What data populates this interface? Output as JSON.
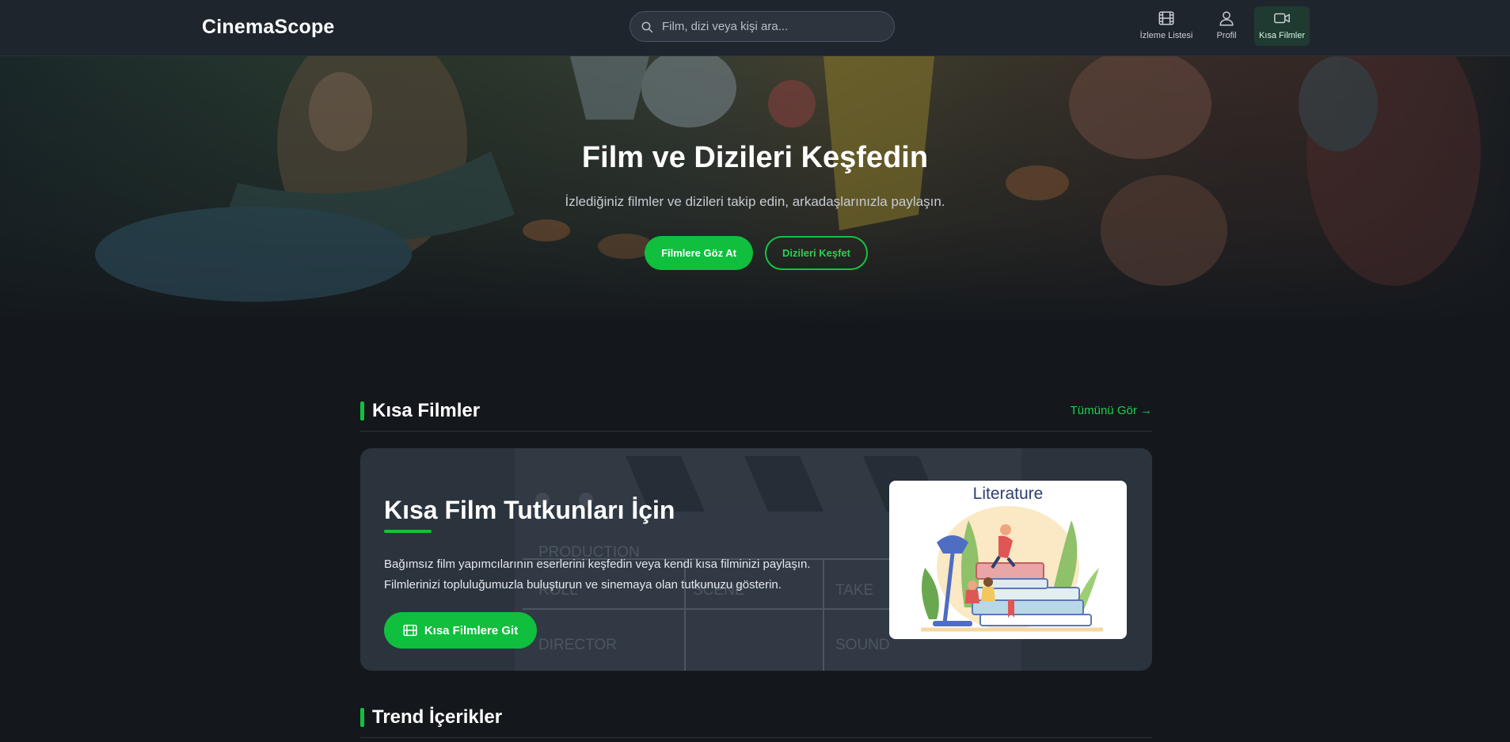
{
  "header": {
    "logo": "CinemaScope",
    "search_placeholder": "Film, dizi veya kişi ara...",
    "nav": [
      {
        "label": "İzleme Listesi",
        "icon": "film-icon",
        "active": false
      },
      {
        "label": "Profil",
        "icon": "user-icon",
        "active": false
      },
      {
        "label": "Kısa Filmler",
        "icon": "video-icon",
        "active": true
      }
    ]
  },
  "hero": {
    "title": "Film ve Dizileri Keşfedin",
    "subtitle": "İzlediğiniz filmler ve dizileri takip edin, arkadaşlarınızla paylaşın.",
    "primary_button": "Filmlere Göz At",
    "secondary_button": "Dizileri Keşfet"
  },
  "short_films": {
    "section_title": "Kısa Filmler",
    "see_all": "Tümünü Gör →",
    "card_title": "Kısa Film Tutkunları İçin",
    "description_line1": "Bağımsız film yapımcılarının eserlerini keşfedin veya kendi kısa filminizi paylaşın.",
    "description_line2": "Filmlerinizi topluluğumuzla buluşturun ve sinemaya olan tutkunuzu gösterin.",
    "button_label": "Kısa Filmlere Git",
    "illustration_label": "Literature",
    "clapper_text": {
      "production": "PRODUCTION",
      "roll": "ROLL",
      "scene": "SCENE",
      "take": "TAKE",
      "director": "DIRECTOR",
      "sound": "SOUND"
    }
  },
  "trending": {
    "section_title": "Trend İçerikler"
  },
  "colors": {
    "accent": "#0fbf3d",
    "background": "#14181d",
    "navbar": "#1f252d",
    "card": "#2b333d"
  }
}
